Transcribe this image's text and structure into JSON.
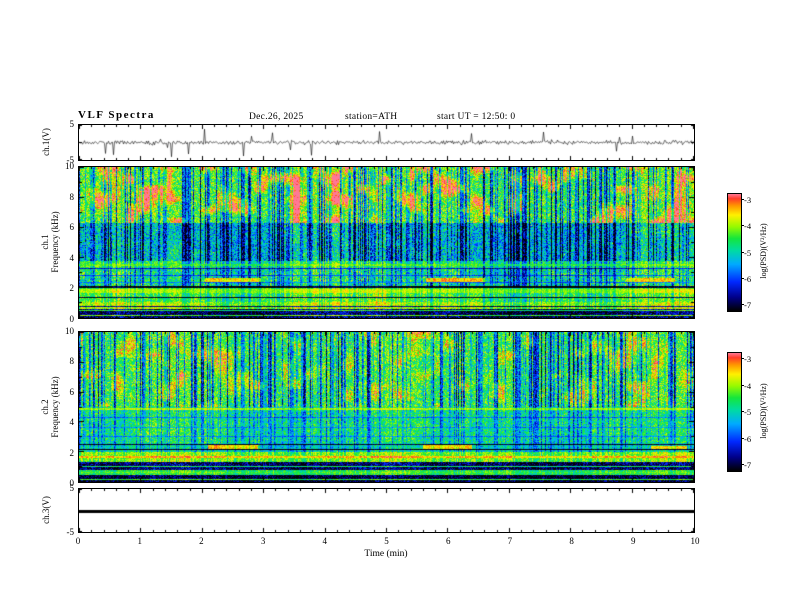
{
  "header": {
    "title": "VLF Spectra",
    "date": "Dec.26, 2025",
    "station": "station=ATH",
    "start_ut": "start UT = 12:50: 0"
  },
  "axes": {
    "time_label": "Time (min)",
    "time_ticks": [
      "0",
      "1",
      "2",
      "3",
      "4",
      "5",
      "6",
      "7",
      "8",
      "9",
      "10"
    ],
    "time_range_min": [
      0,
      10
    ],
    "freq_ticks": [
      "0",
      "2",
      "4",
      "6",
      "8",
      "10"
    ],
    "freq_range_khz": [
      0,
      10
    ],
    "volt_ticks_top": "5",
    "volt_ticks_bottom": "-5",
    "volt_range": [
      -5,
      5
    ]
  },
  "panels": {
    "wave": {
      "ylabel": "ch.1(V)"
    },
    "spec1": {
      "ylabel_line1": "ch.1",
      "ylabel_line2": "Frequency (kHz)"
    },
    "spec2": {
      "ylabel_line1": "ch.2",
      "ylabel_line2": "Frequency (kHz)"
    },
    "ch3": {
      "ylabel": "ch.3(V)"
    }
  },
  "colorbar": {
    "label": "log(PSD)(V²/Hz)",
    "ticks": [
      "-3",
      "-4",
      "-5",
      "-6",
      "-7"
    ],
    "range": [
      -7,
      -3
    ],
    "stops": [
      {
        "t": 0.0,
        "color": "#000000"
      },
      {
        "t": 0.12,
        "color": "#00008c"
      },
      {
        "t": 0.25,
        "color": "#0028ff"
      },
      {
        "t": 0.4,
        "color": "#00aaff"
      },
      {
        "t": 0.52,
        "color": "#00dca0"
      },
      {
        "t": 0.62,
        "color": "#14e63c"
      },
      {
        "t": 0.72,
        "color": "#96fa00"
      },
      {
        "t": 0.82,
        "color": "#fff000"
      },
      {
        "t": 0.9,
        "color": "#ff9600"
      },
      {
        "t": 0.96,
        "color": "#ff3c28"
      },
      {
        "t": 1.0,
        "color": "#ff7896"
      }
    ]
  },
  "chart_data": [
    {
      "type": "line",
      "name": "ch.1 waveform",
      "x_label": "Time (min)",
      "x_range": [
        0,
        10
      ],
      "y_label": "ch.1(V)",
      "y_range": [
        -5,
        5
      ],
      "summary": "broadband noise of roughly ±0.5 V about 0 V with frequent impulsive sferic spikes reaching ±2 to ±5 V across the full 10 minutes",
      "render": {
        "seed": 11,
        "noise_v": 0.28,
        "spike_prob": 0.035,
        "spike_amp_v": 3.4,
        "big_spike_prob": 0.006,
        "big_spike_amp_v": 5
      }
    },
    {
      "type": "heatmap",
      "name": "ch.1 VLF spectrogram",
      "x_label": "Time (min)",
      "x_range": [
        0,
        10
      ],
      "y_label": "Frequency (kHz)",
      "y_range": [
        0,
        10
      ],
      "z_label": "log(PSD)(V²/Hz)",
      "z_range": [
        -7,
        -3
      ],
      "features": "green background (~ -4.4) above 6 kHz with yellow patches and dense dark-blue vertical sferic streaks; darker blue band 3.8-6.3 kHz (~ -5.1); cyan-green line near 3.5 kHz; banded structure below 2 kHz with black lines near 2.05, 1.35, 0.75 kHz; bright band 0.55-1 kHz; near-black band below 0.55 kHz; orange hiss segments near 2.5 kHz at 2.0-3.0, 5.6-6.6 and 8.9-9.7 min",
      "render": {
        "seed": 101,
        "streak_density": 0.34,
        "bands": [
          {
            "f_low": 6.3,
            "f_high": 10.0,
            "level": -4.35,
            "noise": 0.4,
            "streak": 0.95,
            "patch": 0.85
          },
          {
            "f_low": 3.75,
            "f_high": 6.3,
            "level": -5.15,
            "noise": 0.45,
            "streak": 1.0,
            "patch": 0.15
          },
          {
            "f_low": 3.3,
            "f_high": 3.75,
            "level": -4.55,
            "noise": 0.3,
            "streak": 0.6,
            "patch": 0.1
          },
          {
            "f_low": 2.1,
            "f_high": 3.3,
            "level": -4.8,
            "noise": 0.4,
            "streak": 0.7,
            "patch": 0.2
          },
          {
            "f_low": 1.0,
            "f_high": 2.1,
            "level": -4.35,
            "noise": 0.3,
            "streak": 0.4,
            "patch": 0.1
          },
          {
            "f_low": 0.55,
            "f_high": 1.0,
            "level": -4.0,
            "noise": 0.25,
            "streak": 0.3,
            "patch": 0.1
          },
          {
            "f_low": 0.0,
            "f_high": 0.55,
            "level": -6.6,
            "noise": 0.35,
            "streak": 0.1,
            "patch": 0.0
          }
        ],
        "lines": [
          {
            "f": 3.5,
            "level": -4.25,
            "w": 0.12
          },
          {
            "f": 3.28,
            "level": -6.2,
            "w": 0.1
          },
          {
            "f": 2.8,
            "level": -5.8,
            "w": 0.07
          },
          {
            "f": 2.35,
            "level": -5.6,
            "w": 0.06
          },
          {
            "f": 2.05,
            "level": -6.9,
            "w": 0.12
          },
          {
            "f": 1.75,
            "level": -3.95,
            "w": 0.25
          },
          {
            "f": 1.35,
            "level": -6.8,
            "w": 0.1
          },
          {
            "f": 0.75,
            "level": -6.5,
            "w": 0.08
          },
          {
            "f": 0.45,
            "level": -4.4,
            "w": 0.07
          },
          {
            "f": 0.3,
            "level": -4.7,
            "w": 0.06
          },
          {
            "f": 0.12,
            "level": -4.2,
            "w": 0.07
          }
        ],
        "segments": [
          {
            "x0": 2.05,
            "x1": 2.95,
            "f": 2.5,
            "hw": 0.13,
            "level": -3.4
          },
          {
            "x0": 5.65,
            "x1": 6.6,
            "f": 2.5,
            "hw": 0.13,
            "level": -3.4
          },
          {
            "x0": 8.9,
            "x1": 9.7,
            "f": 2.5,
            "hw": 0.11,
            "level": -3.7
          }
        ]
      }
    },
    {
      "type": "heatmap",
      "name": "ch.2 VLF spectrogram",
      "x_label": "Time (min)",
      "x_range": [
        0,
        10
      ],
      "y_label": "Frequency (kHz)",
      "y_range": [
        0,
        10
      ],
      "z_label": "log(PSD)(V²/Hz)",
      "z_range": [
        -7,
        -3
      ],
      "features": "green background (~ -4.5) above 5 kHz with dark-blue vertical sferic streaks; yellow-green line near 4.85 kHz; smoother cyan-green 2.6-5 kHz with thin dark lines; yellow band 1.3-2 kHz with orange line near 1.65 kHz; black bands near 0.8-1.3 kHz and below 0.45 kHz; green line near 0.6 kHz; orange hiss segments near 2.3 kHz at 2.1-2.9, 5.6-6.4 and 9.3-9.9 min",
      "render": {
        "seed": 202,
        "streak_density": 0.34,
        "bands": [
          {
            "f_low": 5.0,
            "f_high": 10.0,
            "level": -4.45,
            "noise": 0.4,
            "streak": 0.95,
            "patch": 0.5
          },
          {
            "f_low": 2.6,
            "f_high": 5.0,
            "level": -4.7,
            "noise": 0.35,
            "streak": 0.5,
            "patch": 0.15
          },
          {
            "f_low": 2.0,
            "f_high": 2.6,
            "level": -4.9,
            "noise": 0.3,
            "streak": 0.4,
            "patch": 0.1
          },
          {
            "f_low": 1.3,
            "f_high": 2.0,
            "level": -4.05,
            "noise": 0.25,
            "streak": 0.3,
            "patch": 0.1
          },
          {
            "f_low": 0.8,
            "f_high": 1.3,
            "level": -6.5,
            "noise": 0.35,
            "streak": 0.15,
            "patch": 0.0
          },
          {
            "f_low": 0.45,
            "f_high": 0.8,
            "level": -4.4,
            "noise": 0.25,
            "streak": 0.2,
            "patch": 0.0
          },
          {
            "f_low": 0.0,
            "f_high": 0.45,
            "level": -6.7,
            "noise": 0.3,
            "streak": 0.1,
            "patch": 0.0
          }
        ],
        "lines": [
          {
            "f": 4.85,
            "level": -3.9,
            "w": 0.15
          },
          {
            "f": 4.3,
            "level": -5.6,
            "w": 0.08
          },
          {
            "f": 3.6,
            "level": -5.4,
            "w": 0.08
          },
          {
            "f": 3.0,
            "level": -5.5,
            "w": 0.08
          },
          {
            "f": 2.5,
            "level": -6.8,
            "w": 0.1
          },
          {
            "f": 2.15,
            "level": -6.9,
            "w": 0.1
          },
          {
            "f": 1.65,
            "level": -3.35,
            "w": 0.1
          },
          {
            "f": 1.0,
            "level": -4.5,
            "w": 0.08
          },
          {
            "f": 0.6,
            "level": -4.2,
            "w": 0.1
          },
          {
            "f": 0.3,
            "level": -5.0,
            "w": 0.06
          },
          {
            "f": 0.12,
            "level": -4.3,
            "w": 0.07
          }
        ],
        "segments": [
          {
            "x0": 2.1,
            "x1": 2.9,
            "f": 2.3,
            "hw": 0.13,
            "level": -3.5
          },
          {
            "x0": 5.6,
            "x1": 6.4,
            "f": 2.3,
            "hw": 0.13,
            "level": -3.5
          },
          {
            "x0": 9.3,
            "x1": 9.9,
            "f": 2.3,
            "hw": 0.11,
            "level": -3.6
          }
        ]
      }
    },
    {
      "type": "line",
      "name": "ch.3 waveform",
      "x_label": "Time (min)",
      "x_range": [
        0,
        10
      ],
      "y_label": "ch.3(V)",
      "y_range": [
        -5,
        5
      ],
      "summary": "constant ~0 V flat heavy black trace for the full 10 minutes",
      "render": {
        "seed": 7,
        "value_v": 0
      }
    }
  ]
}
